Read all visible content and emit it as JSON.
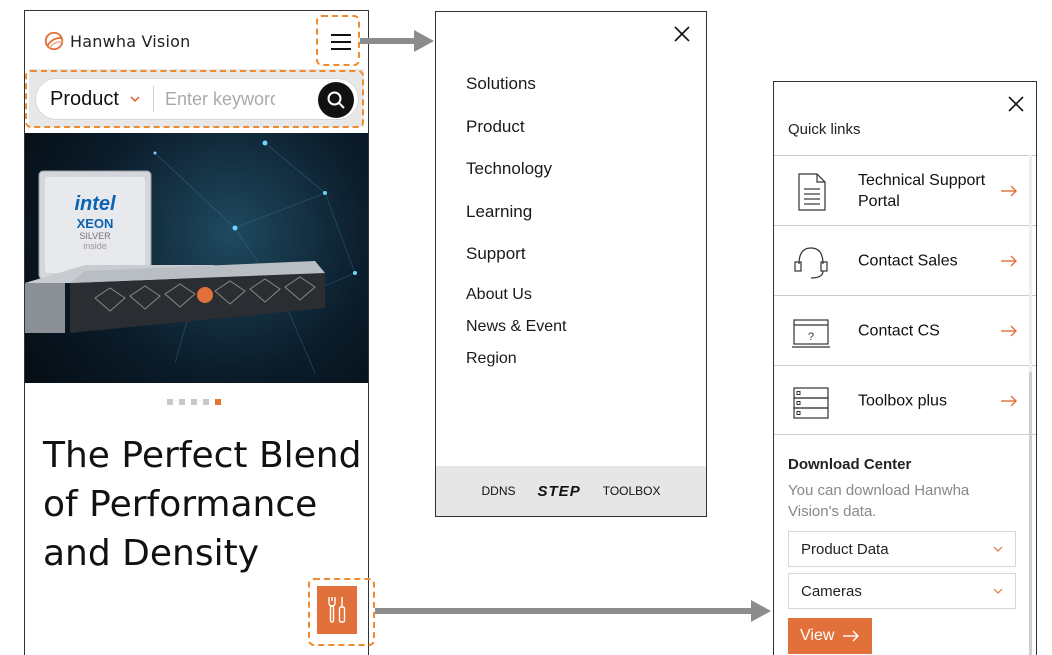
{
  "brand": {
    "name": "Hanwha Vision",
    "accent": "#e2703a",
    "highlight": "#f08a2e"
  },
  "home": {
    "search": {
      "category": "Product",
      "placeholder": "Enter keyword"
    },
    "hero": {
      "chip_brand": "intel",
      "chip_line": "XEON",
      "chip_tier": "SILVER",
      "chip_suffix": "inside"
    },
    "pager": {
      "count": 5,
      "active": 5
    },
    "headline": "The Perfect Blend of Performance and Density"
  },
  "menu": {
    "main_items": [
      "Solutions",
      "Product",
      "Technology",
      "Learning",
      "Support"
    ],
    "sub_items": [
      "About Us",
      "News & Event",
      "Region"
    ],
    "footer": [
      "DDNS",
      "STEP",
      "TOOLBOX"
    ]
  },
  "quick_links": {
    "title": "Quick links",
    "items": [
      {
        "label": "Technical Support Portal",
        "icon": "document-icon"
      },
      {
        "label": "Contact Sales",
        "icon": "headset-icon"
      },
      {
        "label": "Contact CS",
        "icon": "monitor-question-icon"
      },
      {
        "label": "Toolbox plus",
        "icon": "server-rack-icon"
      }
    ],
    "download": {
      "title": "Download Center",
      "description": "You can download Hanwha Vision's data.",
      "select_type": "Product Data",
      "select_category": "Cameras",
      "view_label": "View"
    }
  }
}
